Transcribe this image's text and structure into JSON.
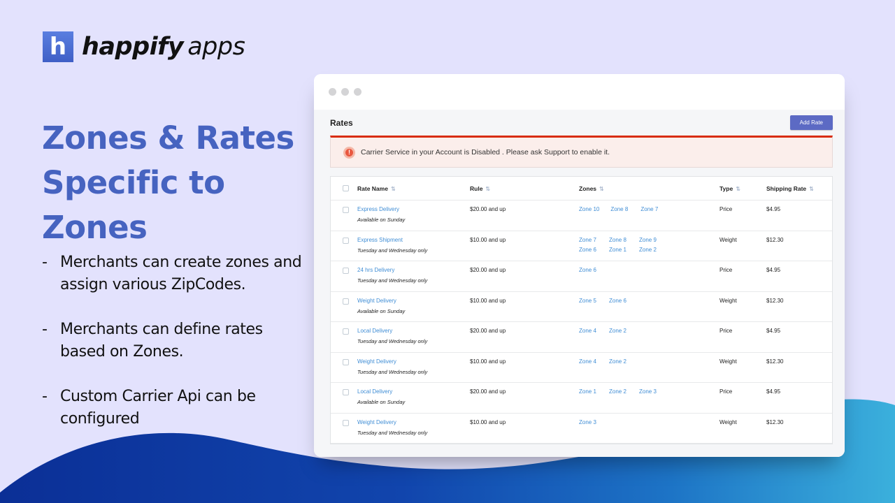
{
  "brand": {
    "logo_letter": "h",
    "name_bold": "happify",
    "name_light": "apps",
    "accent_color": "#4663c0"
  },
  "headline": "Zones & Rates Specific to Zones",
  "bullets": [
    {
      "dash": "-",
      "text": "Merchants can create zones and assign various ZipCodes."
    },
    {
      "dash": "-",
      "text": "Merchants can define rates based on Zones."
    },
    {
      "dash": "-",
      "text": "Custom Carrier Api can be configured"
    }
  ],
  "app": {
    "page_title": "Rates",
    "add_button": "Add Rate",
    "alert": {
      "icon": "alert-circle-icon",
      "text": "Carrier Service in your Account is Disabled . Please ask Support to enable it.",
      "color": "#d82c0d"
    },
    "table": {
      "sort_icon": "⇅",
      "columns": [
        "Rate Name",
        "Rule",
        "Zones",
        "Type",
        "Shipping Rate"
      ],
      "rows": [
        {
          "name": "Express Delivery",
          "sub": "Available on Sunday",
          "rule": "$20.00 and up",
          "zones": [
            "Zone 10",
            "Zone 8",
            "Zone 7"
          ],
          "type": "Price",
          "rate": "$4.95"
        },
        {
          "name": "Express Shipment",
          "sub": "Tuesday and Wednesday only",
          "rule": "$10.00 and up",
          "zones": [
            "Zone 7",
            "Zone 8",
            "Zone 9",
            "Zone 6",
            "Zone 1",
            "Zone 2"
          ],
          "type": "Weight",
          "rate": "$12.30"
        },
        {
          "name": "24 hrs Delivery",
          "sub": "Tuesday and Wednesday only",
          "rule": "$20.00 and up",
          "zones": [
            "Zone 6"
          ],
          "type": "Price",
          "rate": "$4.95"
        },
        {
          "name": "Weight Delivery",
          "sub": "Available on Sunday",
          "rule": "$10.00 and up",
          "zones": [
            "Zone 5",
            "Zone 6"
          ],
          "type": "Weight",
          "rate": "$12.30"
        },
        {
          "name": "Local Delivery",
          "sub": "Tuesday and Wednesday only",
          "rule": "$20.00 and up",
          "zones": [
            "Zone 4",
            "Zone 2"
          ],
          "type": "Price",
          "rate": "$4.95"
        },
        {
          "name": "Weight Delivery",
          "sub": "Tuesday and Wednesday only",
          "rule": "$10.00 and up",
          "zones": [
            "Zone 4",
            "Zone 2"
          ],
          "type": "Weight",
          "rate": "$12.30"
        },
        {
          "name": "Local Delivery",
          "sub": "Available on Sunday",
          "rule": "$20.00 and up",
          "zones": [
            "Zone 1",
            "Zone 2",
            "Zone 3"
          ],
          "type": "Price",
          "rate": "$4.95"
        },
        {
          "name": "Weight Delivery",
          "sub": "Tuesday and Wednesday only",
          "rule": "$10.00 and up",
          "zones": [
            "Zone 3"
          ],
          "type": "Weight",
          "rate": "$12.30"
        }
      ]
    }
  }
}
